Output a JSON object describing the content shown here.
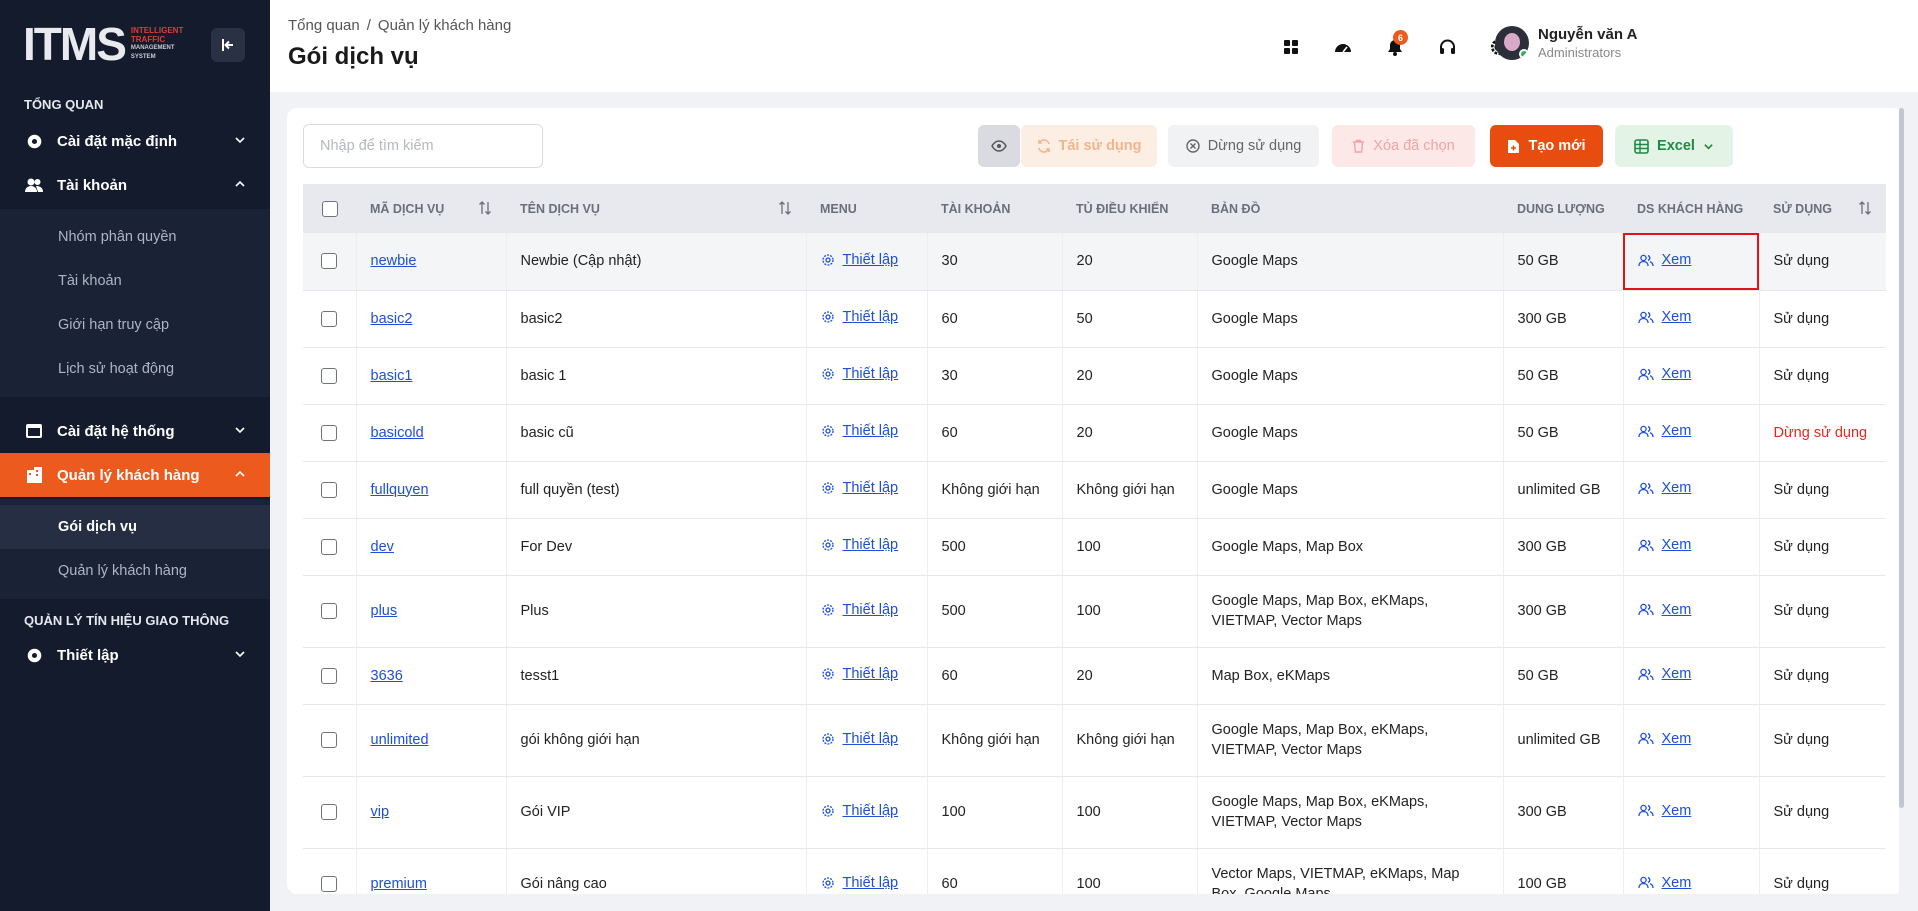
{
  "sidebar": {
    "logo_text": "ITMS",
    "logo_sub_1": "INTELLIGENT",
    "logo_sub_2": "TRAFFIC",
    "logo_sub_3": "MANAGEMENT SYSTEM",
    "section_overview": "TỔNG QUAN",
    "menu_default_settings": "Cài đặt mặc định",
    "menu_account": "Tài khoản",
    "account_sub": [
      "Nhóm phân quyền",
      "Tài khoản",
      "Giới hạn truy cập",
      "Lịch sử hoạt động"
    ],
    "menu_system_settings": "Cài đặt hệ thống",
    "menu_customer_mgmt": "Quản lý khách hàng",
    "customer_sub": [
      "Gói dịch vụ",
      "Quản lý khách hàng"
    ],
    "section_traffic": "QUẢN LÝ TÍN HIỆU GIAO THÔNG",
    "menu_setup": "Thiết lập"
  },
  "header": {
    "breadcrumb_home": "Tổng quan",
    "breadcrumb_sep": "/",
    "breadcrumb_current": "Quản lý khách hàng",
    "title": "Gói dịch vụ",
    "notification_count": "6",
    "user_name": "Nguyễn văn A",
    "user_role": "Administrators"
  },
  "toolbar": {
    "search_placeholder": "Nhập để tìm kiếm",
    "reuse_label": "Tái sử dụng",
    "stop_label": "Dừng sử dụng",
    "delete_label": "Xóa đã chọn",
    "create_label": "Tạo mới",
    "excel_label": "Excel"
  },
  "table": {
    "columns": [
      "MÃ DỊCH VỤ",
      "TÊN DỊCH VỤ",
      "MENU",
      "TÀI KHOẢN",
      "TỦ ĐIỀU KHIỂN",
      "BẢN ĐỒ",
      "DUNG LƯỢNG",
      "DS KHÁCH HÀNG",
      "SỬ DỤNG"
    ],
    "menu_link": "Thiết lập",
    "view_link": "Xem",
    "rows": [
      {
        "code": "newbie",
        "name": "Newbie (Cập nhật)",
        "accounts": "30",
        "controllers": "20",
        "maps": "Google Maps",
        "storage": "50 GB",
        "status": "Sử dụng"
      },
      {
        "code": "basic2",
        "name": "basic2",
        "accounts": "60",
        "controllers": "50",
        "maps": "Google Maps",
        "storage": "300 GB",
        "status": "Sử dụng"
      },
      {
        "code": "basic1",
        "name": "basic 1",
        "accounts": "30",
        "controllers": "20",
        "maps": "Google Maps",
        "storage": "50 GB",
        "status": "Sử dụng"
      },
      {
        "code": "basicold",
        "name": "basic cũ",
        "accounts": "60",
        "controllers": "20",
        "maps": "Google Maps",
        "storage": "50 GB",
        "status": "Dừng sử dụng"
      },
      {
        "code": "fullquyen",
        "name": "full quyền (test)",
        "accounts": "Không giới hạn",
        "controllers": "Không giới hạn",
        "maps": "Google Maps",
        "storage": "unlimited GB",
        "status": "Sử dụng"
      },
      {
        "code": "dev",
        "name": "For Dev",
        "accounts": "500",
        "controllers": "100",
        "maps": "Google Maps, Map Box",
        "storage": "300 GB",
        "status": "Sử dụng"
      },
      {
        "code": "plus",
        "name": "Plus",
        "accounts": "500",
        "controllers": "100",
        "maps": "Google Maps, Map Box, eKMaps, VIETMAP, Vector Maps",
        "storage": "300 GB",
        "status": "Sử dụng"
      },
      {
        "code": "3636",
        "name": "tesst1",
        "accounts": "60",
        "controllers": "20",
        "maps": "Map Box, eKMaps",
        "storage": "50 GB",
        "status": "Sử dụng"
      },
      {
        "code": "unlimited",
        "name": "gói không giới hạn",
        "accounts": "Không giới hạn",
        "controllers": "Không giới hạn",
        "maps": "Google Maps, Map Box, eKMaps, VIETMAP, Vector Maps",
        "storage": "unlimited GB",
        "status": "Sử dụng"
      },
      {
        "code": "vip",
        "name": "Gói VIP",
        "accounts": "100",
        "controllers": "100",
        "maps": "Google Maps, Map Box, eKMaps, VIETMAP, Vector Maps",
        "storage": "300 GB",
        "status": "Sử dụng"
      },
      {
        "code": "premium",
        "name": "Gói nâng cao",
        "accounts": "60",
        "controllers": "100",
        "maps": "Vector Maps, VIETMAP, eKMaps, Map Box, Google Maps",
        "storage": "100 GB",
        "status": "Sử dụng"
      }
    ]
  },
  "colors": {
    "accent": "#ec5a1e",
    "sidebar_bg": "#141b2d",
    "link": "#1d4fd8",
    "status_stopped": "#e5281f",
    "highlight_box": "#e3131b"
  }
}
